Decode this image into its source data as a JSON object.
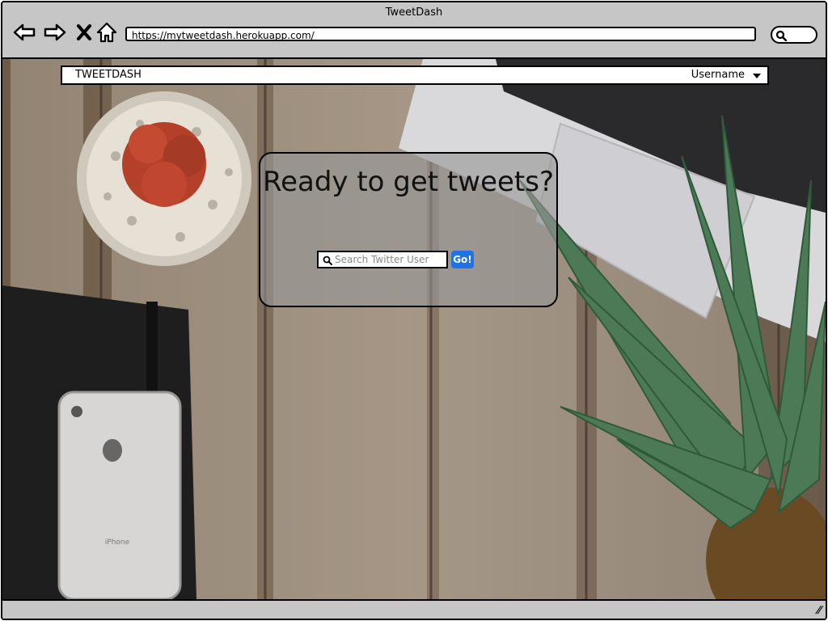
{
  "browser": {
    "title": "TweetDash",
    "url": "https://mytweetdash.herokuapp.com/"
  },
  "app": {
    "brand": "TWEETDASH",
    "user_menu_label": "Username"
  },
  "hero": {
    "heading": "Ready to get tweets?",
    "search_placeholder": "Search Twitter User",
    "go_label": "Go!"
  },
  "colors": {
    "accent": "#1e73e8",
    "chrome": "#c6c6c6"
  },
  "background_photo": {
    "label": "iPhone"
  }
}
